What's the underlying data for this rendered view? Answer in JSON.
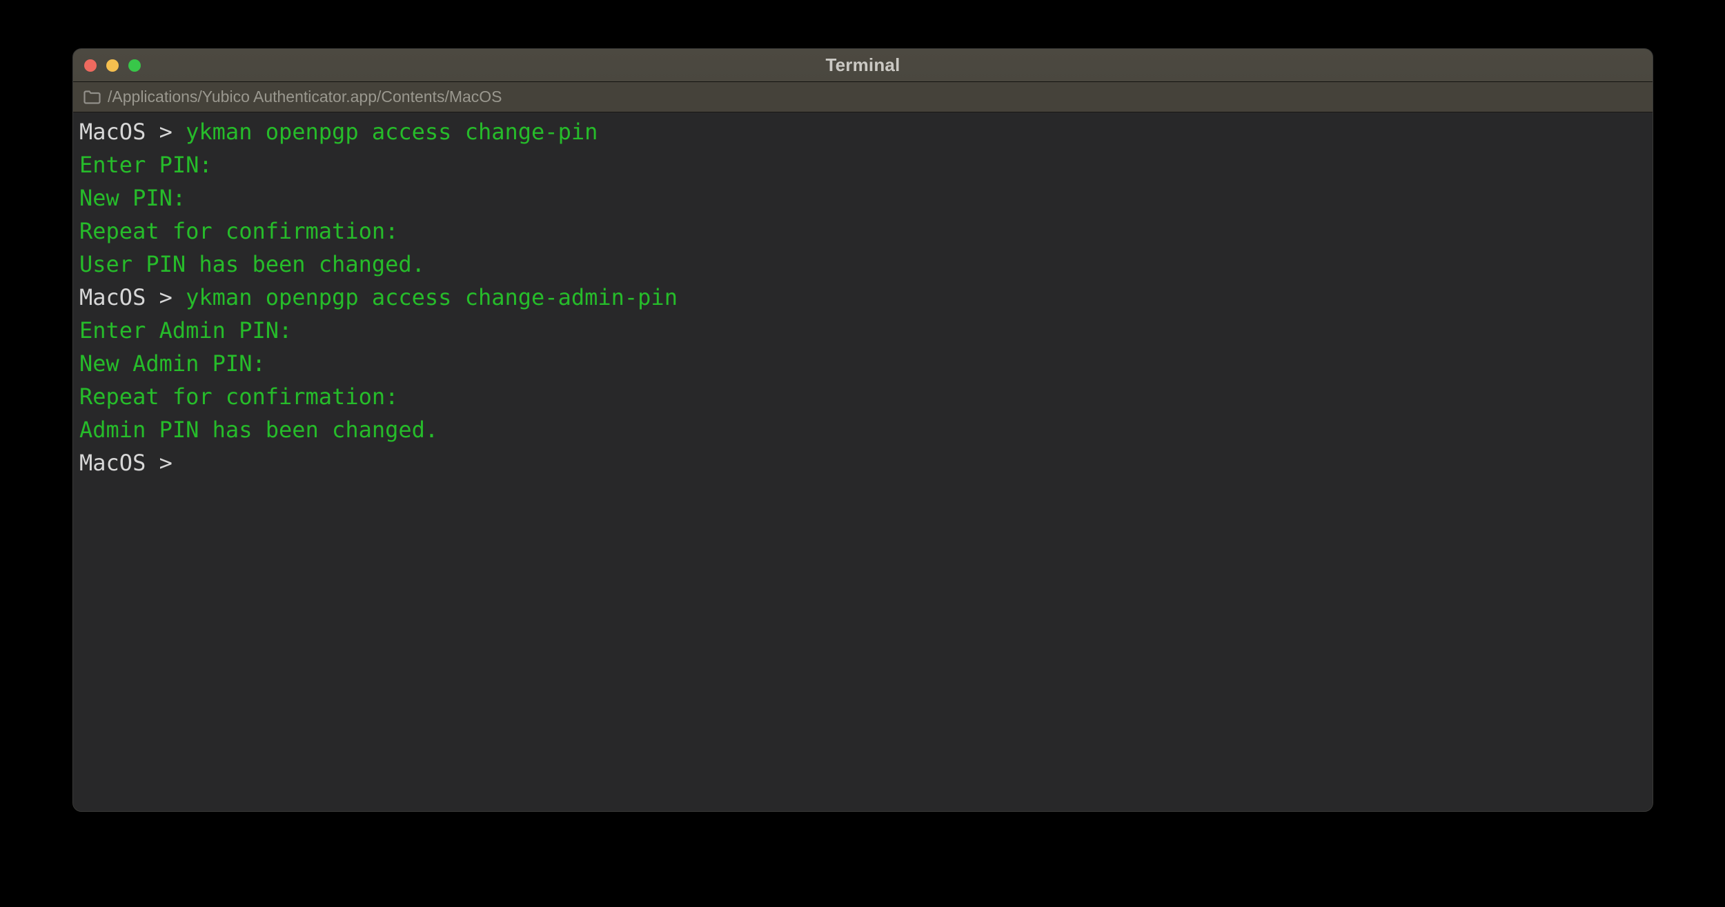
{
  "window": {
    "title": "Terminal"
  },
  "traffic_lights": {
    "close": "close",
    "minimize": "minimize",
    "zoom": "zoom"
  },
  "path_bar": {
    "path": "/Applications/Yubico Authenticator.app/Contents/MacOS",
    "icon": "folder-icon"
  },
  "colors": {
    "terminal_bg": "#282829",
    "titlebar_bg": "#4a473f",
    "pathbar_bg": "#45423a",
    "title_text": "#cbc9c4",
    "path_text": "#9a988f",
    "prompt_text": "#d7d7d7",
    "command_text": "#26bc2a",
    "light_close": "#ee6a5f",
    "light_minimize": "#f5bf4f",
    "light_zoom": "#38c749"
  },
  "terminal": {
    "lines": [
      {
        "prompt": "MacOS > ",
        "text": "ykman openpgp access change-pin"
      },
      {
        "prompt": "",
        "text": "Enter PIN:"
      },
      {
        "prompt": "",
        "text": "New PIN:"
      },
      {
        "prompt": "",
        "text": "Repeat for confirmation:"
      },
      {
        "prompt": "",
        "text": "User PIN has been changed."
      },
      {
        "prompt": "MacOS > ",
        "text": "ykman openpgp access change-admin-pin"
      },
      {
        "prompt": "",
        "text": "Enter Admin PIN:"
      },
      {
        "prompt": "",
        "text": "New Admin PIN:"
      },
      {
        "prompt": "",
        "text": "Repeat for confirmation:"
      },
      {
        "prompt": "",
        "text": "Admin PIN has been changed."
      },
      {
        "prompt": "MacOS > ",
        "text": ""
      }
    ]
  }
}
